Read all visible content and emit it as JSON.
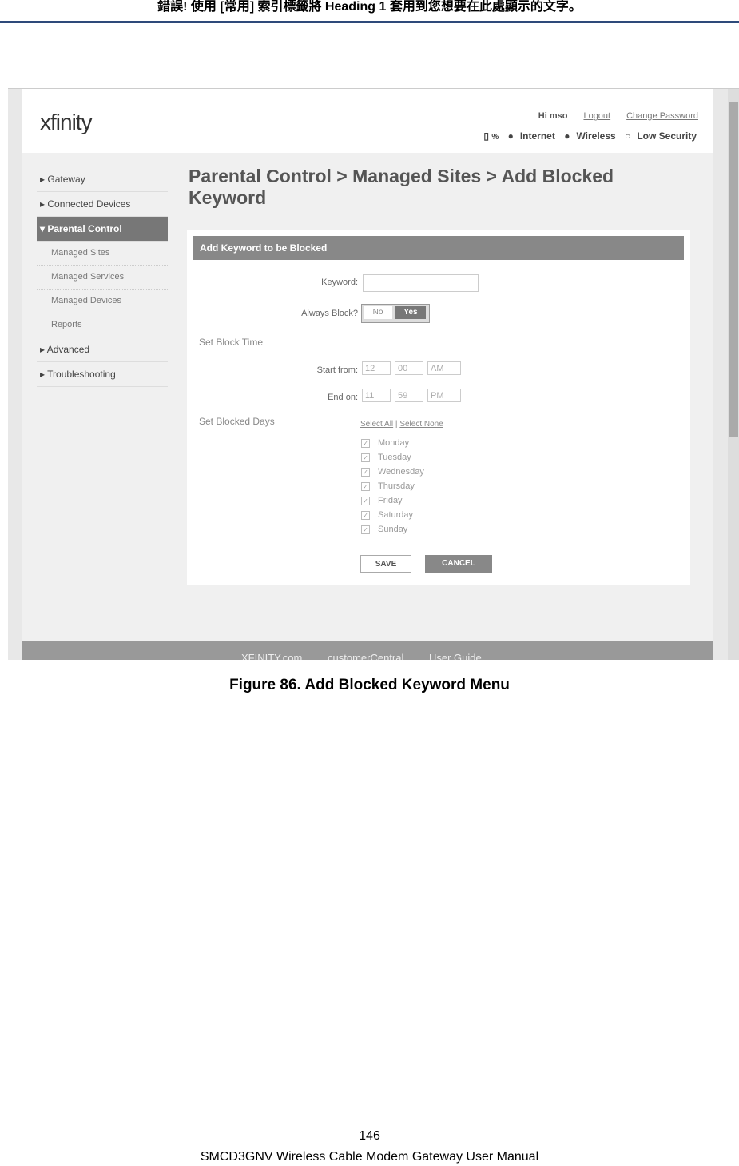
{
  "page_header": "錯誤! 使用 [常用] 索引標籤將 Heading 1 套用到您想要在此處顯示的文字。",
  "screenshot": {
    "logo": "xfinity",
    "greeting": "Hi mso",
    "logout": "Logout",
    "change_password": "Change Password",
    "battery": "%",
    "status": [
      "Internet",
      "Wireless",
      "Low Security"
    ],
    "sidebar": [
      {
        "label": "Gateway"
      },
      {
        "label": "Connected Devices"
      },
      {
        "label": "Parental Control",
        "active": true,
        "children": [
          "Managed Sites",
          "Managed Services",
          "Managed Devices",
          "Reports"
        ]
      },
      {
        "label": "Advanced"
      },
      {
        "label": "Troubleshooting"
      }
    ],
    "title": "Parental Control > Managed Sites > Add Blocked Keyword",
    "form_title": "Add Keyword to be Blocked",
    "keyword_label": "Keyword:",
    "keyword_value": "",
    "always_block_label": "Always Block?",
    "no": "No",
    "yes": "Yes",
    "always_block": "Yes",
    "set_block_time": "Set Block Time",
    "start_label": "Start from:",
    "start": [
      "12",
      "00",
      "AM"
    ],
    "end_label": "End on:",
    "end": [
      "11",
      "59",
      "PM"
    ],
    "set_blocked_days": "Set Blocked Days",
    "select_all": "Select All",
    "sep": "|",
    "select_none": "Select None",
    "days": [
      "Monday",
      "Tuesday",
      "Wednesday",
      "Thursday",
      "Friday",
      "Saturday",
      "Sunday"
    ],
    "save": "SAVE",
    "cancel": "CANCEL",
    "footer_links": [
      "XFINITY.com",
      "customerCentral",
      "User Guide"
    ]
  },
  "caption": "Figure 86. Add Blocked Keyword Menu",
  "page_number": "146",
  "footer": "SMCD3GNV Wireless Cable Modem Gateway User Manual"
}
